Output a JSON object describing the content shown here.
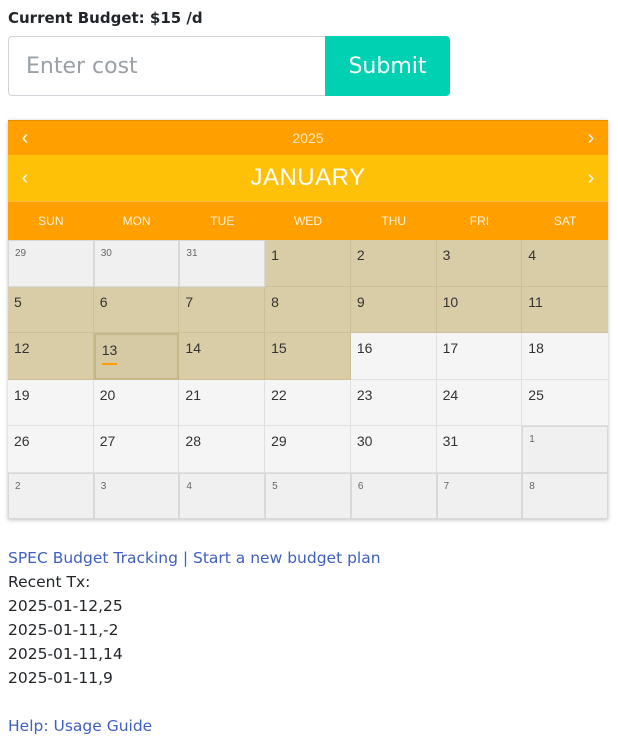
{
  "budget": {
    "label": "Current Budget: $15 /d"
  },
  "form": {
    "placeholder": "Enter cost",
    "submit_label": "Submit"
  },
  "calendar": {
    "year": "2025",
    "month": "JANUARY",
    "prev_arrow": "‹",
    "next_arrow": "›",
    "weekdays": [
      "SUN",
      "MON",
      "TUE",
      "WED",
      "THU",
      "FRI",
      "SAT"
    ],
    "days": [
      {
        "label": "29",
        "type": "other"
      },
      {
        "label": "30",
        "type": "other"
      },
      {
        "label": "31",
        "type": "other"
      },
      {
        "label": "1",
        "type": "spent"
      },
      {
        "label": "2",
        "type": "spent"
      },
      {
        "label": "3",
        "type": "spent"
      },
      {
        "label": "4",
        "type": "spent"
      },
      {
        "label": "5",
        "type": "spent"
      },
      {
        "label": "6",
        "type": "spent"
      },
      {
        "label": "7",
        "type": "spent"
      },
      {
        "label": "8",
        "type": "spent"
      },
      {
        "label": "9",
        "type": "spent"
      },
      {
        "label": "10",
        "type": "spent"
      },
      {
        "label": "11",
        "type": "spent"
      },
      {
        "label": "12",
        "type": "spent"
      },
      {
        "label": "13",
        "type": "today"
      },
      {
        "label": "14",
        "type": "spent"
      },
      {
        "label": "15",
        "type": "spent"
      },
      {
        "label": "16",
        "type": "normal"
      },
      {
        "label": "17",
        "type": "normal"
      },
      {
        "label": "18",
        "type": "normal"
      },
      {
        "label": "19",
        "type": "normal"
      },
      {
        "label": "20",
        "type": "normal"
      },
      {
        "label": "21",
        "type": "normal"
      },
      {
        "label": "22",
        "type": "normal"
      },
      {
        "label": "23",
        "type": "normal"
      },
      {
        "label": "24",
        "type": "normal"
      },
      {
        "label": "25",
        "type": "normal"
      },
      {
        "label": "26",
        "type": "normal"
      },
      {
        "label": "27",
        "type": "normal"
      },
      {
        "label": "28",
        "type": "normal"
      },
      {
        "label": "29",
        "type": "normal"
      },
      {
        "label": "30",
        "type": "normal"
      },
      {
        "label": "31",
        "type": "normal"
      },
      {
        "label": "1",
        "type": "other"
      },
      {
        "label": "2",
        "type": "other"
      },
      {
        "label": "3",
        "type": "other"
      },
      {
        "label": "4",
        "type": "other"
      },
      {
        "label": "5",
        "type": "other"
      },
      {
        "label": "6",
        "type": "other"
      },
      {
        "label": "7",
        "type": "other"
      },
      {
        "label": "8",
        "type": "other"
      }
    ]
  },
  "links": {
    "tracking": "SPEC Budget Tracking",
    "separator": " | ",
    "new_plan": "Start a new budget plan",
    "help": "Help: Usage Guide"
  },
  "transactions": {
    "title": "Recent Tx:",
    "items": [
      "2025-01-12,25",
      "2025-01-11,-2",
      "2025-01-11,14",
      "2025-01-11,9"
    ]
  },
  "colors": {
    "accent": "#00d1b2",
    "calendar_orange": "#ff9f00",
    "calendar_yellow": "#ffc107",
    "spent_day": "#d9cda8",
    "link": "#4060c0"
  }
}
